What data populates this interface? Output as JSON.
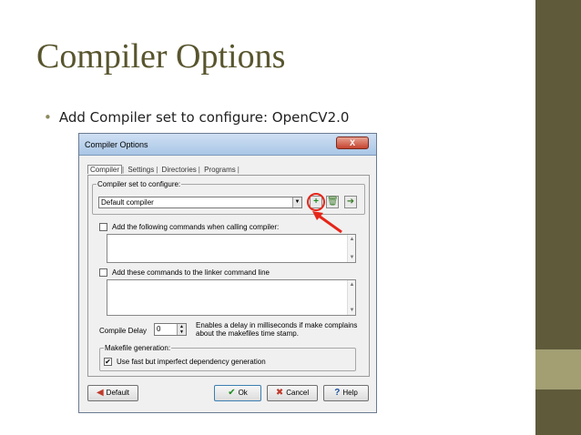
{
  "slide": {
    "title": "Compiler Options",
    "bullet": "Add Compiler set to configure: OpenCV2.0"
  },
  "dialog": {
    "title": "Compiler Options",
    "close_label": "X",
    "tabs": [
      "Compiler",
      "Settings",
      "Directories",
      "Programs"
    ],
    "compiler_set": {
      "label": "Compiler set to configure:",
      "value": "Default compiler"
    },
    "add_compiler_commands": {
      "label": "Add the following commands when calling compiler:",
      "checked": false
    },
    "add_linker_commands": {
      "label": "Add these commands to the linker command line",
      "checked": false
    },
    "compile_delay": {
      "label": "Compile Delay",
      "value": "0",
      "hint_line1": "Enables a delay in milliseconds if make complains",
      "hint_line2": "about the makefiles time stamp."
    },
    "makefile": {
      "label": "Makefile generation:",
      "option_label": "Use fast but imperfect dependency generation",
      "checked": true,
      "check_mark": "✔"
    },
    "buttons": {
      "default_label": "Default",
      "ok_label": "Ok",
      "cancel_label": "Cancel",
      "help_label": "Help"
    }
  },
  "colors": {
    "accent_strip": "#5e5a3a",
    "title_color": "#58552e",
    "highlight_red": "#e52619"
  },
  "icons": {
    "add_compiler": "plus-icon",
    "delete_compiler": "trash-icon",
    "rename_compiler": "arrow-icon"
  }
}
